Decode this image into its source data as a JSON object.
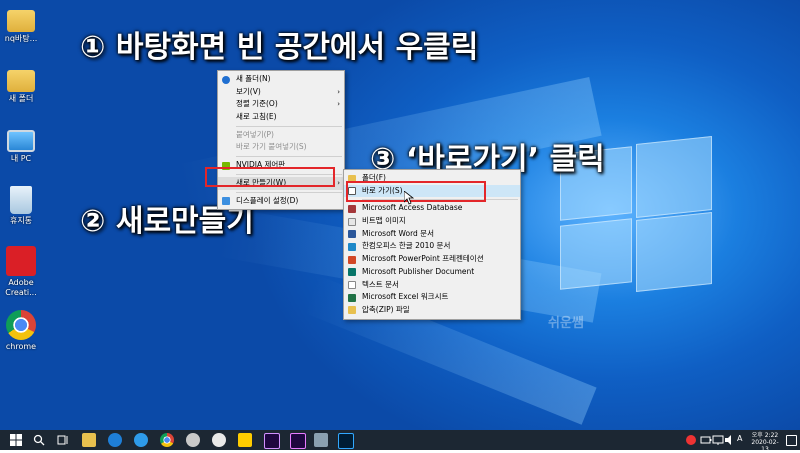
{
  "callouts": {
    "step1": "① 바탕화면 빈 공간에서 우클릭",
    "step2": "② 새로만들기",
    "step3": "③ ‘바로가기’ 클릭"
  },
  "desktop_icons": [
    {
      "label": "nq바탕...",
      "icon": "folder-icon"
    },
    {
      "label": "새 폴더",
      "icon": "folder-icon"
    },
    {
      "label": "내 PC",
      "icon": "computer-icon"
    },
    {
      "label": "휴지통",
      "icon": "recycle-bin-icon"
    },
    {
      "label": "Adobe Creati...",
      "icon": "adobe-cc-icon"
    },
    {
      "label": "chrome",
      "icon": "chrome-icon"
    }
  ],
  "context_menu": {
    "items": [
      {
        "label": "새 폴더(N)"
      },
      {
        "label": "보기(V)"
      },
      {
        "label": "정렬 기준(O)"
      },
      {
        "label": "새로 고침(E)"
      },
      {
        "label": "붙여넣기(P)"
      },
      {
        "label": "바로 가기 붙여넣기(S)"
      },
      {
        "label": "NVIDIA 제어판"
      },
      {
        "label": "새로 만들기(W)"
      },
      {
        "label": "디스플레이 설정(D)"
      }
    ]
  },
  "submenu": {
    "items": [
      {
        "label": "폴더(F)"
      },
      {
        "label": "바로 가기(S)"
      },
      {
        "label": "Microsoft Access Database"
      },
      {
        "label": "비트맵 이미지"
      },
      {
        "label": "Microsoft Word 문서"
      },
      {
        "label": "한컴오피스 한글 2010 문서"
      },
      {
        "label": "Microsoft PowerPoint 프레젠테이션"
      },
      {
        "label": "Microsoft Publisher Document"
      },
      {
        "label": "텍스트 문서"
      },
      {
        "label": "Microsoft Excel 워크시트"
      },
      {
        "label": "압축(ZIP) 파일"
      }
    ]
  },
  "watermark": "쉬운쌤",
  "taskbar": {
    "time": "오후 2:22",
    "date": "2020-02-13",
    "ime": "A"
  },
  "colors": {
    "highlight_box": "#e3262a",
    "taskbar": "#1c2733"
  }
}
